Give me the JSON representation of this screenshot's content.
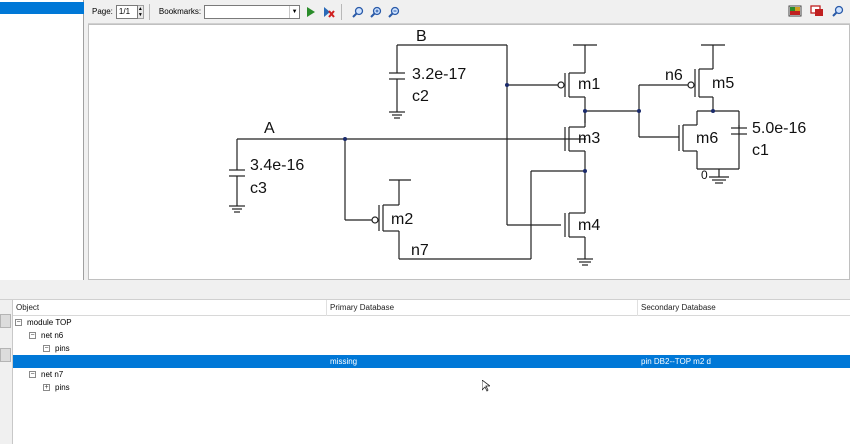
{
  "toolbar": {
    "page_label": "Page:",
    "page_value": "1/1",
    "bookmarks_label": "Bookmarks:",
    "bookmarks_value": ""
  },
  "schematic": {
    "net_labels": {
      "A": "A",
      "B": "B",
      "n6": "n6",
      "n7": "n7",
      "zero": "0"
    },
    "transistors": [
      "m1",
      "m2",
      "m3",
      "m4",
      "m5",
      "m6"
    ],
    "capacitors": [
      {
        "name": "c1",
        "value": "5.0e-16"
      },
      {
        "name": "c2",
        "value": "3.2e-17"
      },
      {
        "name": "c3",
        "value": "3.4e-16"
      }
    ]
  },
  "table": {
    "columns": [
      "Object",
      "Primary Database",
      "Secondary Database"
    ],
    "rows": [
      {
        "label": "module TOP",
        "primary": "",
        "secondary": "",
        "expander": "⊟",
        "selected": false
      },
      {
        "label": "net n6",
        "primary": "",
        "secondary": "",
        "expander": "⊟",
        "selected": false
      },
      {
        "label": "pins",
        "primary": "",
        "secondary": "",
        "expander": "⊟",
        "selected": false
      },
      {
        "label": "",
        "primary": "missing",
        "secondary": "pin DB2--TOP m2 d",
        "expander": "",
        "selected": true
      },
      {
        "label": "net n7",
        "primary": "",
        "secondary": "",
        "expander": "⊟",
        "selected": false
      },
      {
        "label": "pins",
        "primary": "",
        "secondary": "",
        "expander": "⊞",
        "selected": false
      }
    ]
  }
}
